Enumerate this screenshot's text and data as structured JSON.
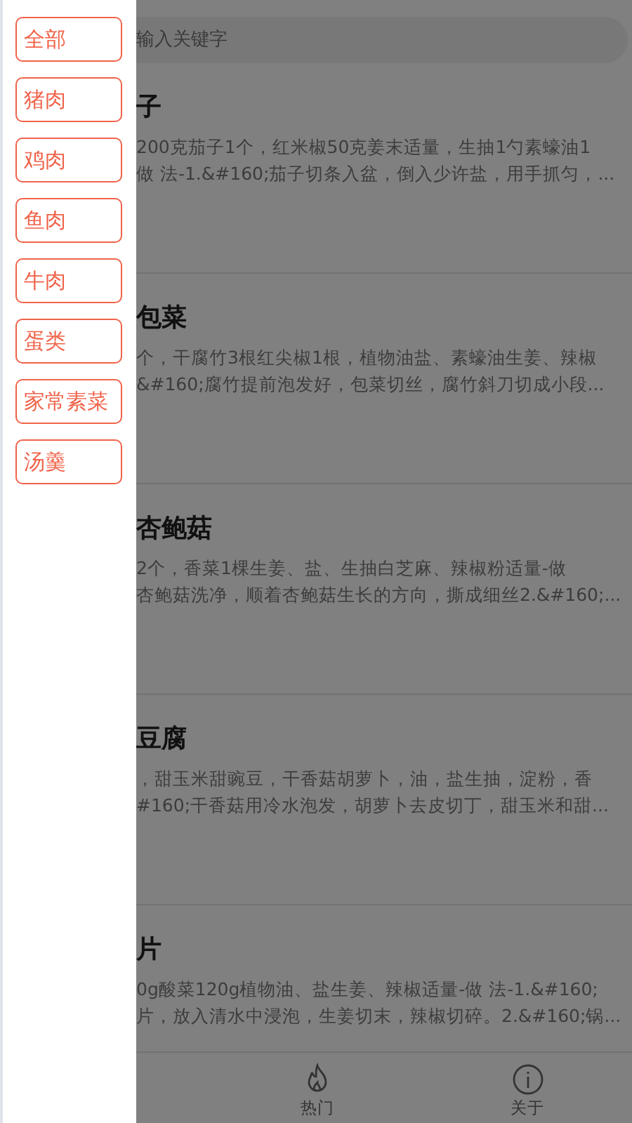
{
  "drawer": {
    "categories": [
      {
        "label": "全部"
      },
      {
        "label": "猪肉"
      },
      {
        "label": "鸡肉"
      },
      {
        "label": "鱼肉"
      },
      {
        "label": "牛肉"
      },
      {
        "label": "蛋类"
      },
      {
        "label": "家常素菜"
      },
      {
        "label": "汤羹"
      }
    ]
  },
  "search": {
    "placeholder": "输入关键字"
  },
  "recipes": [
    {
      "title": "子",
      "lines": [
        "200克茄子1个，红米椒50克姜末适量，生抽1勺素蠔油1",
        "做 法-1.&#160;茄子切条入盆，倒入少许盐，用手抓匀，..."
      ]
    },
    {
      "title": "包菜",
      "lines": [
        "个，干腐竹3根红尖椒1根，植物油盐、素蠔油生姜、辣椒",
        "&#160;腐竹提前泡发好，包菜切丝，腐竹斜刀切成小段..."
      ]
    },
    {
      "title": "杏鲍菇",
      "lines": [
        "2个，香菜1棵生姜、盐、生抽白芝麻、辣椒粉适量-做",
        "杏鲍菇洗净，顺着杏鲍菇生长的方向，撕成细丝2.&#160;..."
      ]
    },
    {
      "title": "豆腐",
      "lines": [
        "，甜玉米甜豌豆，干香菇胡萝卜，油，盐生抽，淀粉，香",
        "#160;干香菇用冷水泡发，胡萝卜去皮切丁，甜玉米和甜..."
      ]
    },
    {
      "title": "片",
      "lines": [
        "0g酸菜120g植物油、盐生姜、辣椒适量-做 法-1.&#160;",
        "片，放入清水中浸泡，生姜切末，辣椒切碎。2.&#160;锅..."
      ]
    }
  ],
  "tab_bar": {
    "items": [
      {
        "kind": "flame",
        "label": "热门"
      },
      {
        "kind": "info",
        "label": "关于"
      }
    ]
  }
}
